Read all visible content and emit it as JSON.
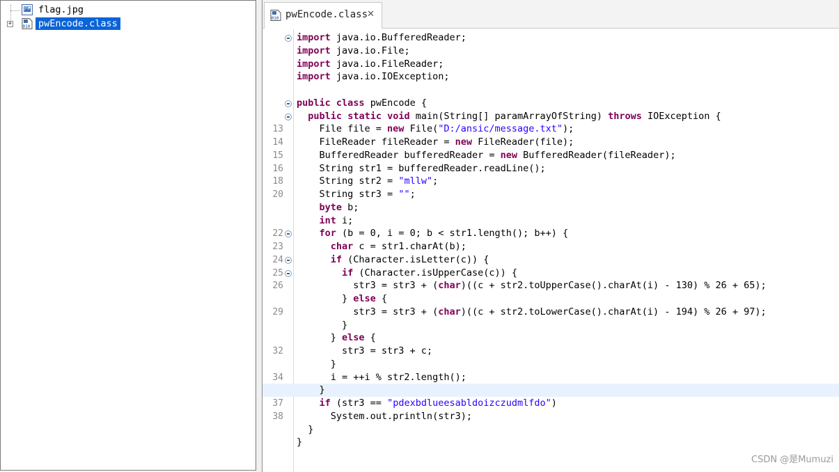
{
  "tree": {
    "items": [
      {
        "label": "flag.jpg",
        "icon": "image-file-icon",
        "selected": false
      },
      {
        "label": "pwEncode.class",
        "icon": "class-file-icon",
        "selected": true,
        "expander": "+"
      }
    ]
  },
  "editor": {
    "tab": {
      "label": "pwEncode.class",
      "close_glyph": "✕",
      "icon": "class-file-icon"
    },
    "lines": [
      {
        "num": "",
        "fold": true,
        "text": "import java.io.BufferedReader;"
      },
      {
        "num": "",
        "fold": false,
        "text": "import java.io.File;"
      },
      {
        "num": "",
        "fold": false,
        "text": "import java.io.FileReader;"
      },
      {
        "num": "",
        "fold": false,
        "text": "import java.io.IOException;"
      },
      {
        "num": "",
        "fold": false,
        "text": ""
      },
      {
        "num": "",
        "fold": true,
        "text": "public class pwEncode {"
      },
      {
        "num": "",
        "fold": true,
        "text": "  public static void main(String[] paramArrayOfString) throws IOException {"
      },
      {
        "num": "13",
        "fold": false,
        "text": "    File file = new File(\"D:/ansic/message.txt\");"
      },
      {
        "num": "14",
        "fold": false,
        "text": "    FileReader fileReader = new FileReader(file);"
      },
      {
        "num": "15",
        "fold": false,
        "text": "    BufferedReader bufferedReader = new BufferedReader(fileReader);"
      },
      {
        "num": "16",
        "fold": false,
        "text": "    String str1 = bufferedReader.readLine();"
      },
      {
        "num": "18",
        "fold": false,
        "text": "    String str2 = \"mllw\";"
      },
      {
        "num": "20",
        "fold": false,
        "text": "    String str3 = \"\";"
      },
      {
        "num": "",
        "fold": false,
        "text": "    byte b;"
      },
      {
        "num": "",
        "fold": false,
        "text": "    int i;"
      },
      {
        "num": "22",
        "fold": true,
        "text": "    for (b = 0, i = 0; b < str1.length(); b++) {"
      },
      {
        "num": "23",
        "fold": false,
        "text": "      char c = str1.charAt(b);"
      },
      {
        "num": "24",
        "fold": true,
        "text": "      if (Character.isLetter(c)) {"
      },
      {
        "num": "25",
        "fold": true,
        "text": "        if (Character.isUpperCase(c)) {"
      },
      {
        "num": "26",
        "fold": false,
        "text": "          str3 = str3 + (char)((c + str2.toUpperCase().charAt(i) - 130) % 26 + 65);"
      },
      {
        "num": "",
        "fold": false,
        "text": "        } else {"
      },
      {
        "num": "29",
        "fold": false,
        "text": "          str3 = str3 + (char)((c + str2.toLowerCase().charAt(i) - 194) % 26 + 97);"
      },
      {
        "num": "",
        "fold": false,
        "text": "        }"
      },
      {
        "num": "",
        "fold": false,
        "text": "      } else {"
      },
      {
        "num": "32",
        "fold": false,
        "text": "        str3 = str3 + c;"
      },
      {
        "num": "",
        "fold": false,
        "text": "      }"
      },
      {
        "num": "34",
        "fold": false,
        "text": "      i = ++i % str2.length();"
      },
      {
        "num": "",
        "fold": false,
        "text": "    }",
        "current": true
      },
      {
        "num": "37",
        "fold": false,
        "text": "    if (str3 == \"pdexbdlueesabldoizczudmlfdo\")"
      },
      {
        "num": "38",
        "fold": false,
        "text": "      System.out.println(str3);"
      },
      {
        "num": "",
        "fold": false,
        "text": "  }"
      },
      {
        "num": "",
        "fold": false,
        "text": "}"
      }
    ]
  },
  "watermark": "CSDN @是Mumuzi",
  "colors": {
    "keyword": "#7f0055",
    "string": "#2a00ff",
    "selection": "#0a64d8",
    "current_line": "#e8f2fe"
  }
}
